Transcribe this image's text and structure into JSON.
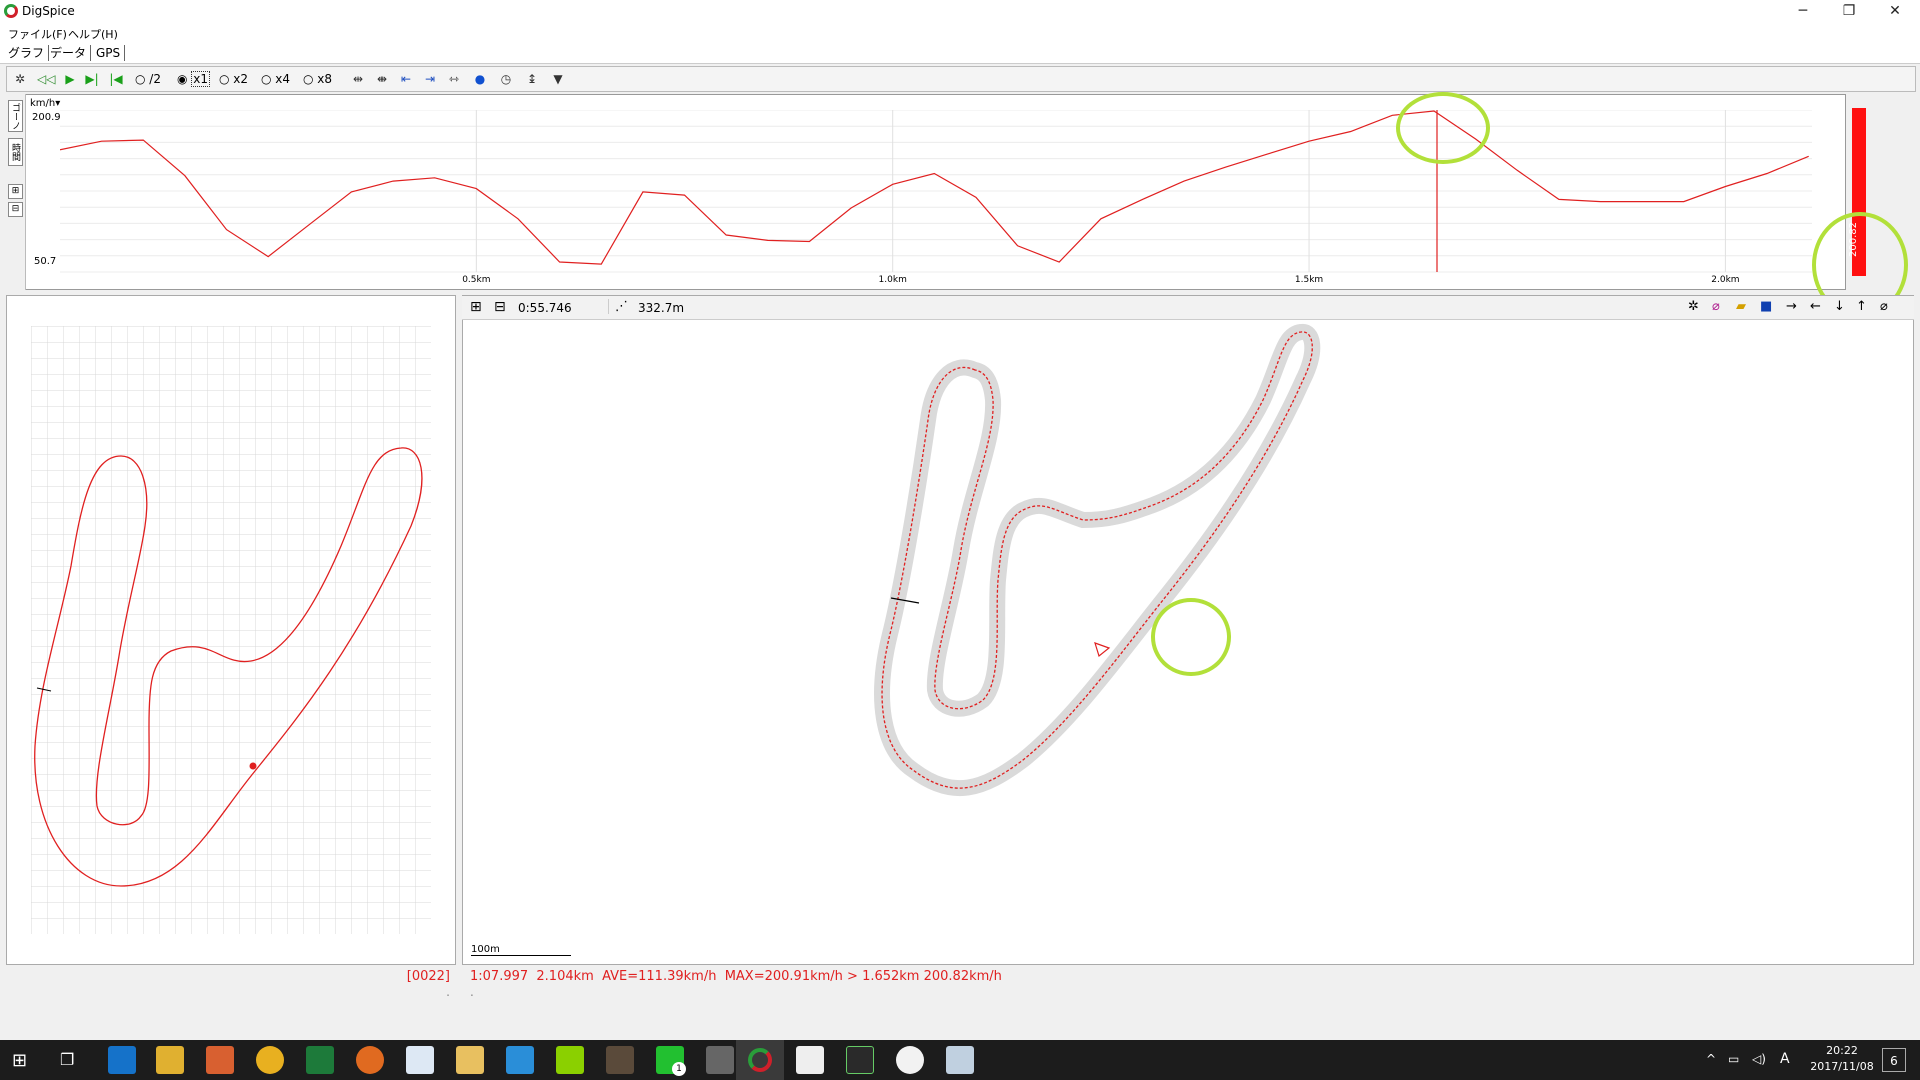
{
  "window": {
    "title": "DigSpice",
    "minimize": "─",
    "restore": "❐",
    "close": "✕"
  },
  "menu": [
    "ファイル(F)",
    "ヘルプ(H)"
  ],
  "tabs": [
    "グラフ",
    "データ",
    "GPS"
  ],
  "toolbar": {
    "playback_options": [
      "/2",
      "x1",
      "x2",
      "x4",
      "x8"
    ],
    "selected": "x1"
  },
  "graph": {
    "unit": "km/h▾",
    "y_max": "200.9",
    "y_min": "50.7",
    "x_ticks": [
      "0.5km",
      "1.0km",
      "1.5km",
      "2.0km"
    ],
    "side_labels": [
      "ゴーノ",
      "時間"
    ],
    "speed_readout": "200.82",
    "series_color": "#e02020"
  },
  "map": {
    "time": "0:55.746",
    "distance": "332.7m",
    "scale": "100m"
  },
  "status": {
    "lap_index": "[0022]",
    "summary": "1:07.997  2.104km  AVE=111.39km/h  MAX=200.91km/h > 1.652km 200.82km/h",
    "dots": ".",
    "dots2": "."
  },
  "taskbar": {
    "time": "20:22",
    "date": "2017/11/08",
    "ime": "A",
    "notif_count": "6",
    "line_badge": "1"
  },
  "chart_data": {
    "type": "line",
    "ylim": [
      50.7,
      200.9
    ],
    "xlim": [
      0,
      2.104
    ],
    "x": [
      0.0,
      0.05,
      0.1,
      0.15,
      0.2,
      0.25,
      0.3,
      0.35,
      0.4,
      0.45,
      0.5,
      0.55,
      0.6,
      0.65,
      0.7,
      0.75,
      0.8,
      0.85,
      0.9,
      0.95,
      1.0,
      1.05,
      1.1,
      1.15,
      1.2,
      1.25,
      1.3,
      1.35,
      1.4,
      1.45,
      1.5,
      1.55,
      1.6,
      1.65,
      1.7,
      1.75,
      1.8,
      1.85,
      1.9,
      1.95,
      2.0,
      2.05,
      2.1
    ],
    "series": [
      {
        "values": [
          164,
          172,
          173,
          140,
          90,
          65,
          95,
          125,
          135,
          138,
          128,
          100,
          60,
          58,
          125,
          122,
          85,
          80,
          79,
          110,
          132,
          142,
          120,
          75,
          60,
          100,
          118,
          135,
          148,
          160,
          172,
          181,
          196,
          200,
          174,
          145,
          118,
          116,
          116,
          116,
          130,
          142,
          158
        ]
      }
    ]
  }
}
